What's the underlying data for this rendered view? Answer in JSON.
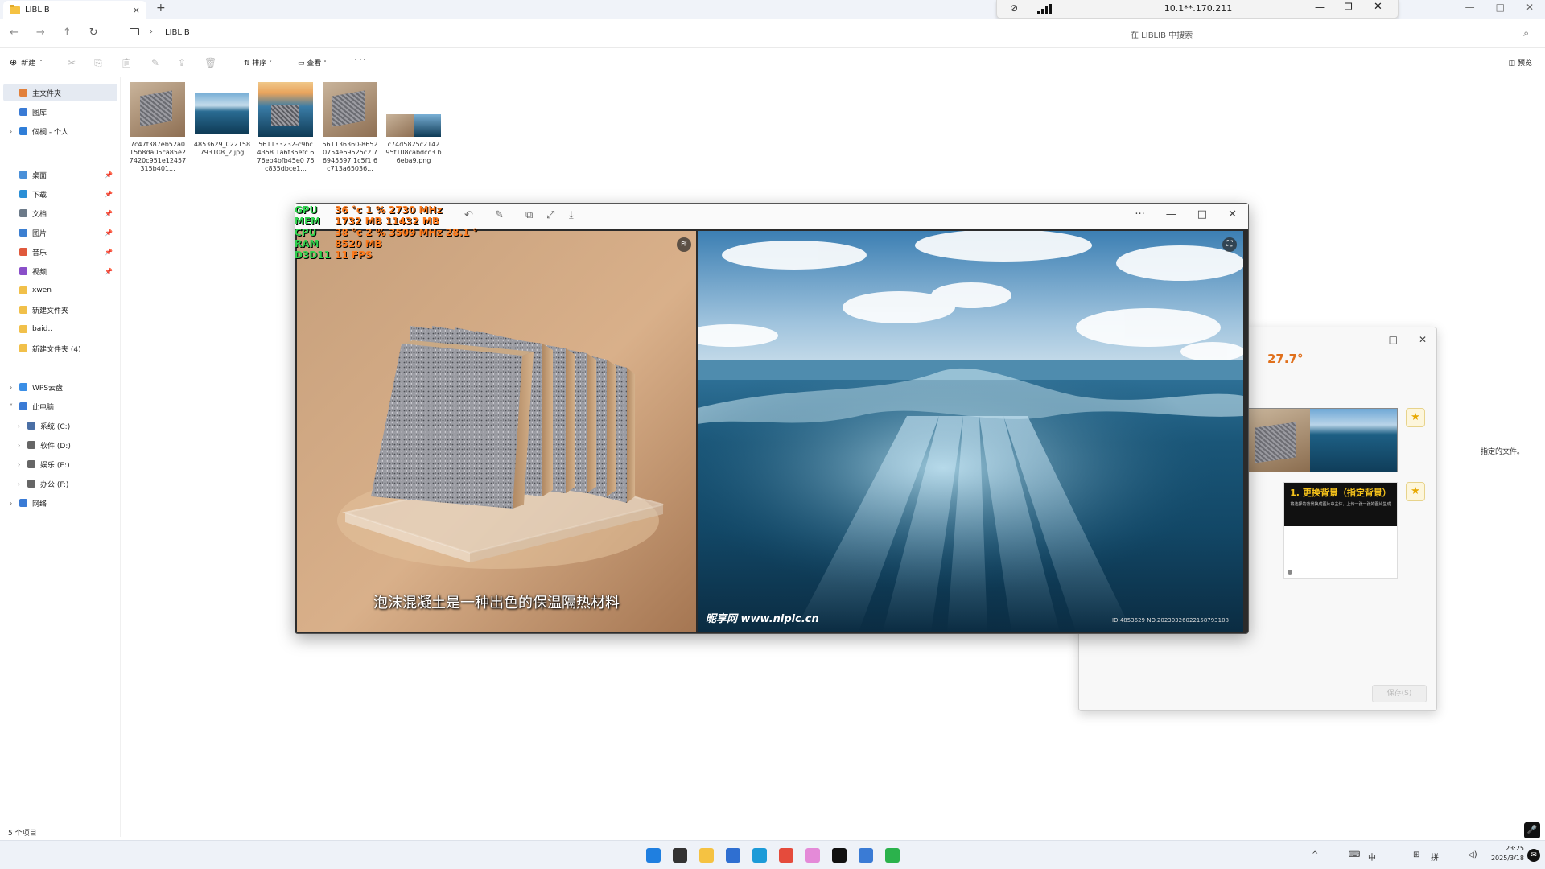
{
  "tab": {
    "title": "LIBLIB",
    "close_glyph": "×",
    "new_glyph": "+"
  },
  "window_controls": {
    "minimize": "—",
    "maximize": "□",
    "close": "✕"
  },
  "remote": {
    "address": "10.1**.170.211",
    "minimize": "—",
    "restore": "❐",
    "close": "✕"
  },
  "address_bar": {
    "back": "←",
    "forward": "→",
    "up": "↑",
    "refresh": "↻",
    "breadcrumb_sep": "›",
    "breadcrumb": "LIBLIB",
    "search_placeholder": "在 LIBLIB 中搜索",
    "search_glyph": "⌕"
  },
  "command_bar": {
    "new_label": "新建",
    "sort_label": "排序",
    "view_label": "查看",
    "more": "···",
    "preview_label": "预览",
    "icons": [
      "cut-icon",
      "copy-icon",
      "paste-icon",
      "rename-icon",
      "share-icon",
      "delete-icon"
    ]
  },
  "sidebar": {
    "items": [
      {
        "label": "主文件夹",
        "color": "#e2803a",
        "selected": true
      },
      {
        "label": "图库",
        "color": "#3a7bd5"
      },
      {
        "label": "個桐 - 个人",
        "color": "#2f7ed8",
        "expandable": true
      },
      {
        "label": "桌面",
        "color": "#4a90d9",
        "pinned": true
      },
      {
        "label": "下载",
        "color": "#2a8fd6",
        "pinned": true
      },
      {
        "label": "文档",
        "color": "#6c7a89",
        "pinned": true
      },
      {
        "label": "图片",
        "color": "#3c7fd1",
        "pinned": true
      },
      {
        "label": "音乐",
        "color": "#e0593c",
        "pinned": true
      },
      {
        "label": "视频",
        "color": "#8a4fc9",
        "pinned": true
      },
      {
        "label": "xwen",
        "color": "#f1c04a"
      },
      {
        "label": "新建文件夹",
        "color": "#f1c04a"
      },
      {
        "label": "baid..",
        "color": "#f1c04a"
      },
      {
        "label": "新建文件夹 (4)",
        "color": "#f1c04a"
      },
      {
        "label": "WPS云盘",
        "color": "#3a8ee6",
        "expandable": true
      },
      {
        "label": "此电脑",
        "color": "#3a7bd5",
        "expanded": true
      },
      {
        "label": "系统 (C:)",
        "color": "#4a6fa5",
        "expandable": true
      },
      {
        "label": "软件 (D:)",
        "color": "#666",
        "expandable": true
      },
      {
        "label": "娱乐 (E:)",
        "color": "#666",
        "expandable": true
      },
      {
        "label": "办公 (F:)",
        "color": "#666",
        "expandable": true
      },
      {
        "label": "网络",
        "color": "#3a7bd5",
        "expandable": true
      }
    ],
    "pin_glyph": "📌",
    "collapsed_glyph": "›",
    "expanded_glyph": "˅"
  },
  "files": [
    {
      "name": "7c47f387eb52a015b8da05ca85e27420c951e12457315b401...",
      "kind": "sponge"
    },
    {
      "name": "4853629_022158793108_2.jpg",
      "kind": "ocean"
    },
    {
      "name": "561133232-c9bc4358 1a6f35efc 676eb4bfb45e0 75c835dbce1...",
      "kind": "ocean-sponge"
    },
    {
      "name": "561136360-86520754e69525c2 76945597 1c5f1 6c713a65036...",
      "kind": "sponge"
    },
    {
      "name": "c74d5825c2142 95f108cabdcc3 b6eba9.png",
      "kind": "combo"
    }
  ],
  "status": "5 个项目",
  "viewer": {
    "tool_icons": [
      "rotate-icon",
      "edit-icon",
      "compare-icon",
      "fit-icon",
      "download-icon"
    ],
    "more": "···",
    "minimize": "—",
    "maximize": "□",
    "close": "✕",
    "subtitle": "泡沫混凝土是一种出色的保温隔热材料",
    "watermark": "昵享网 www.nipic.cn",
    "watermark_id": "ID:4853629 NO.20230326022158793108",
    "pane_buttons": [
      "≋",
      "⛶"
    ]
  },
  "osd": {
    "lines": [
      {
        "label": "GPU",
        "values": "36 °c   1 %   2730 MHz"
      },
      {
        "label": "MEM",
        "values": "1732 MB   11432 MB"
      },
      {
        "label": "CPU",
        "values": "38 °c   2 %   3509 MHz   28.1 °"
      },
      {
        "label": "RAM",
        "values": "8520 MB"
      },
      {
        "label": "D3D11",
        "values": "11 FPS"
      }
    ]
  },
  "dialog": {
    "temp": "27.7°",
    "side_text": "指定的文件。",
    "card_title": "1. 更换背景（指定背景）",
    "card_sub": "将选择的背景换成图片中主体，上传一张一张的图片生成",
    "save": "保存(S)",
    "star": "★",
    "minimize": "—",
    "maximize": "□",
    "close": "✕"
  },
  "taskbar": {
    "apps": [
      "windows-start",
      "task-view",
      "file-explorer",
      "store",
      "edge",
      "wps",
      "cat-app",
      "tiktok",
      "notepad",
      "wechat"
    ],
    "tray_text": [
      "^",
      "⌨",
      "中",
      "⊞",
      "拼",
      "◁)"
    ],
    "time": "23:25",
    "date": "2025/3/18",
    "notification": "✉",
    "mic": "🎤"
  },
  "colors": {
    "accent": "#0067c0",
    "osd_label": "#2fd34e",
    "osd_value": "#ff7b1c"
  }
}
